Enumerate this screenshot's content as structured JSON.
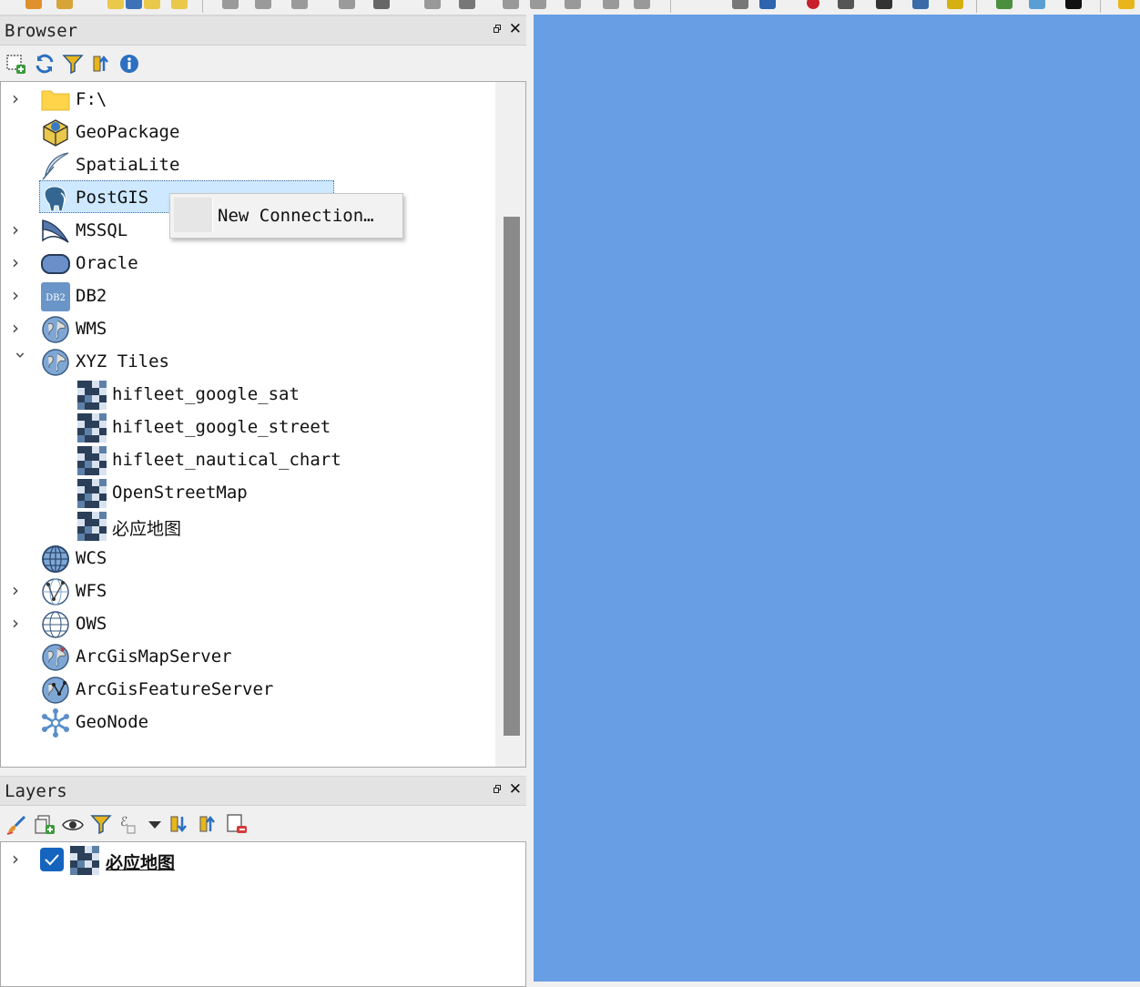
{
  "browser": {
    "title": "Browser",
    "items": [
      {
        "label": "F:\\",
        "icon": "folder-icon",
        "expander": "collapsed"
      },
      {
        "label": "GeoPackage",
        "icon": "geopackage-icon",
        "expander": "none"
      },
      {
        "label": "SpatiaLite",
        "icon": "feather-icon",
        "expander": "none"
      },
      {
        "label": "PostGIS",
        "icon": "elephant-icon",
        "expander": "none"
      },
      {
        "label": "MSSQL",
        "icon": "mssql-icon",
        "expander": "collapsed"
      },
      {
        "label": "Oracle",
        "icon": "oracle-icon",
        "expander": "collapsed"
      },
      {
        "label": "DB2",
        "icon": "db2-icon",
        "expander": "collapsed"
      },
      {
        "label": "WMS",
        "icon": "globe-icon",
        "expander": "collapsed"
      },
      {
        "label": "XYZ Tiles",
        "icon": "globe-icon",
        "expander": "expanded"
      },
      {
        "label": "hifleet_google_sat",
        "icon": "tiles-icon",
        "expander": "none"
      },
      {
        "label": "hifleet_google_street",
        "icon": "tiles-icon",
        "expander": "none"
      },
      {
        "label": "hifleet_nautical_chart",
        "icon": "tiles-icon",
        "expander": "none"
      },
      {
        "label": "OpenStreetMap",
        "icon": "tiles-icon",
        "expander": "none"
      },
      {
        "label": "必应地图",
        "icon": "tiles-icon",
        "expander": "none"
      },
      {
        "label": "WCS",
        "icon": "wcs-globe-icon",
        "expander": "none"
      },
      {
        "label": "WFS",
        "icon": "wfs-globe-icon",
        "expander": "collapsed"
      },
      {
        "label": "OWS",
        "icon": "ows-globe-icon",
        "expander": "collapsed"
      },
      {
        "label": "ArcGisMapServer",
        "icon": "arcgis-globe-icon",
        "expander": "none"
      },
      {
        "label": "ArcGisFeatureServer",
        "icon": "arcgis-feature-icon",
        "expander": "none"
      },
      {
        "label": "GeoNode",
        "icon": "geonode-icon",
        "expander": "none"
      }
    ],
    "selected": "PostGIS"
  },
  "context_menu": {
    "items": [
      {
        "label": "New Connection…"
      }
    ]
  },
  "layers": {
    "title": "Layers",
    "items": [
      {
        "label": "必应地图",
        "checked": true,
        "icon": "tiles-icon"
      }
    ]
  },
  "colors": {
    "map_background": "#679ee4",
    "selection": "#cde8ff",
    "checkbox": "#1565c0"
  }
}
